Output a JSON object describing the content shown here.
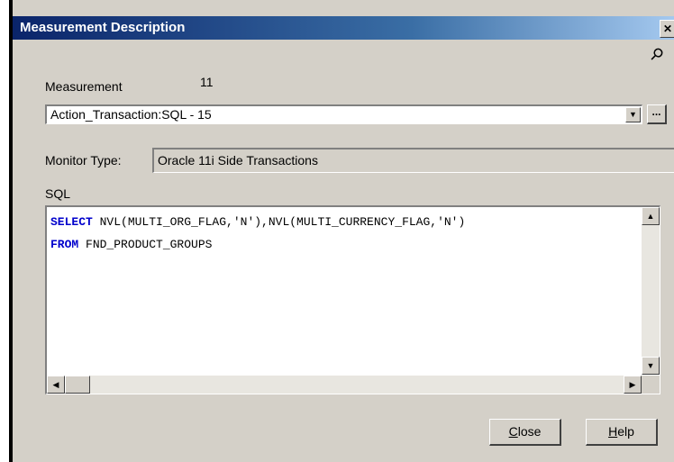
{
  "window": {
    "title": "Measurement Description",
    "close_glyph": "✕"
  },
  "measurement": {
    "label": "Measurement",
    "count": "11",
    "selected": "Action_Transaction:SQL - 15",
    "browse_label": "..."
  },
  "monitor": {
    "label": "Monitor Type:",
    "value": "Oracle 11i Side Transactions"
  },
  "sql": {
    "label": "SQL",
    "line1_keyword": "SELECT",
    "line1_rest": " NVL(MULTI_ORG_FLAG,'N'),NVL(MULTI_CURRENCY_FLAG,'N')",
    "line2_keyword": "FROM",
    "line2_rest": " FND_PRODUCT_GROUPS"
  },
  "buttons": {
    "close_mnemonic": "C",
    "close_rest": "lose",
    "help_mnemonic": "H",
    "help_rest": "elp"
  },
  "icons": {
    "pin": "pin-icon",
    "dropdown": "chevron-down-icon",
    "scroll_up": "arrow-up-icon",
    "scroll_down": "arrow-down-icon",
    "scroll_left": "arrow-left-icon",
    "scroll_right": "arrow-right-icon"
  }
}
